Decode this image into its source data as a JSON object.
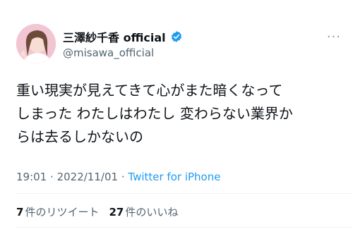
{
  "user": {
    "display_name": "三澤紗千香 official",
    "handle": "@misawa_official",
    "verified": true
  },
  "tweet": {
    "lines": [
      "重い現実が見えてきて心がまた暗くなって",
      "しまった わたしはわたし 変わらない業界か",
      "らは去るしかないの"
    ],
    "time": "19:01",
    "separator1": "·",
    "date": "2022/11/01",
    "separator2": "·",
    "source": "Twitter for iPhone"
  },
  "stats": {
    "retweets_count": "7",
    "retweets_label": "件のリツイート",
    "likes_count": "27",
    "likes_label": "件のいいね"
  },
  "icons": {
    "verified": "verified-badge-icon",
    "more": "more-options-icon"
  },
  "colors": {
    "accent": "#1d9bf0",
    "text": "#0f1419",
    "secondary": "#536471"
  }
}
